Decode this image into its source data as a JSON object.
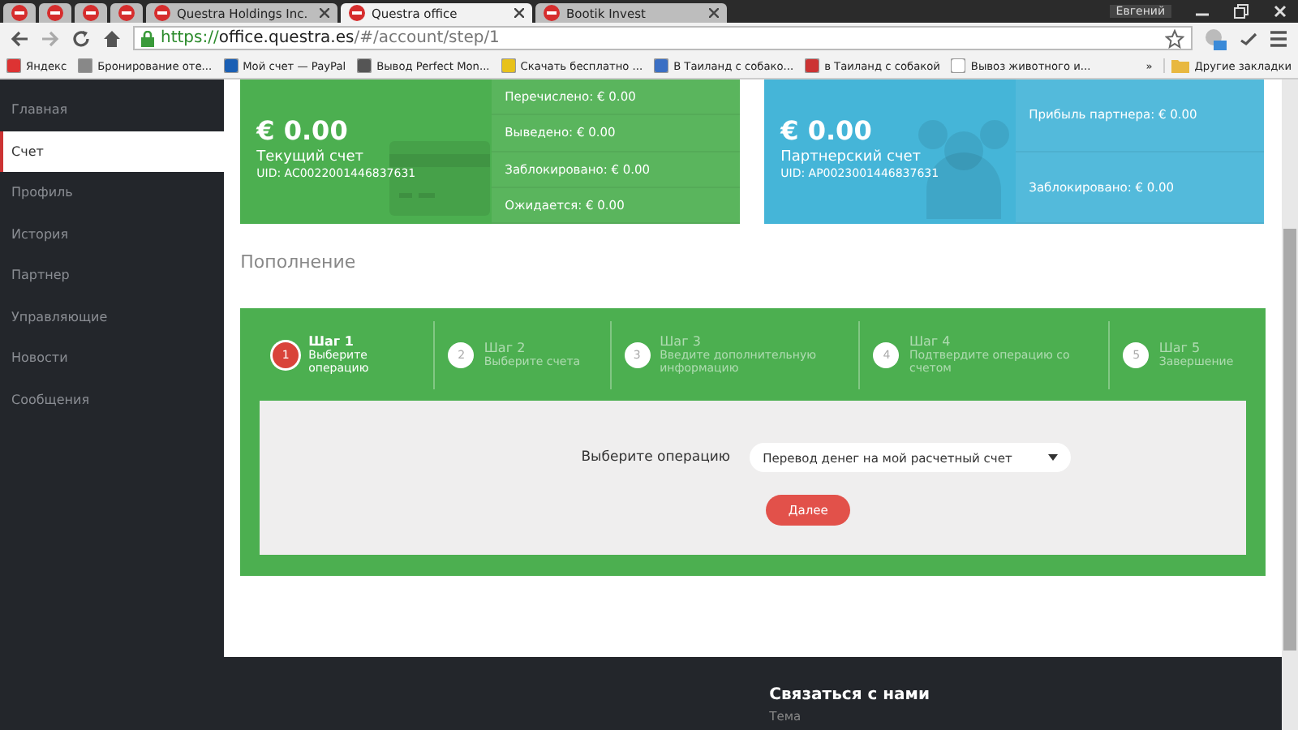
{
  "browser": {
    "tabs": [
      {
        "kind": "pinned",
        "selected": false
      },
      {
        "kind": "pinned",
        "selected": false
      },
      {
        "kind": "pinned",
        "selected": false
      },
      {
        "kind": "pinned",
        "selected": false
      },
      {
        "kind": "titled",
        "label": "Questra Holdings Inc.",
        "selected": false
      },
      {
        "kind": "titled",
        "label": "Questra office",
        "selected": true
      },
      {
        "kind": "titled",
        "label": "Bootik Invest",
        "selected": false
      }
    ],
    "user": "Евгений",
    "url": {
      "scheme": "https://",
      "host": "office.questra.es",
      "path": "/#/account/step/1"
    },
    "bookmarks": [
      "Яндекс",
      "Бронирование оте...",
      "Мой счет — PayPal",
      "Вывод Perfect Mon...",
      "Скачать бесплатно ...",
      "В Таиланд с собако...",
      "в Таиланд с собакой",
      "Вывоз животного и..."
    ],
    "more_bookmarks": "»",
    "other_bookmarks": "Другие закладки"
  },
  "sidebar": {
    "items": [
      {
        "label": "Главная",
        "selected": false
      },
      {
        "label": "Счет",
        "selected": true
      },
      {
        "label": "Профиль",
        "selected": false
      },
      {
        "label": "История",
        "selected": false
      },
      {
        "label": "Партнер",
        "selected": false
      },
      {
        "label": "Управляющие",
        "selected": false
      },
      {
        "label": "Новости",
        "selected": false
      },
      {
        "label": "Сообщения",
        "selected": false
      }
    ]
  },
  "accounts": [
    {
      "kind": "card",
      "color": "#4caf50",
      "amount": "€ 0.00",
      "name": "Текущий счет",
      "uid": "UID: AC0022001446837631",
      "stats": [
        "Перечислено: € 0.00",
        "Выведено: € 0.00",
        "Заблокировано: € 0.00",
        "Ожидается: € 0.00"
      ]
    },
    {
      "kind": "people",
      "color": "#45b5d8",
      "amount": "€ 0.00",
      "name": "Партнерский счет",
      "uid": "UID: AP0023001446837631",
      "stats": [
        "Прибыль партнера: € 0.00",
        "Заблокировано: € 0.00"
      ]
    }
  ],
  "section_title": "Пополнение",
  "steps": [
    {
      "number": "1",
      "title": "Шаг 1",
      "subtitle": "Выберите операцию",
      "selected": true
    },
    {
      "number": "2",
      "title": "Шаг 2",
      "subtitle": "Выберите счета",
      "selected": false
    },
    {
      "number": "3",
      "title": "Шаг 3",
      "subtitle": "Введите дополнительную информацию",
      "selected": false
    },
    {
      "number": "4",
      "title": "Шаг 4",
      "subtitle": "Подтвердите операцию со счетом",
      "selected": false
    },
    {
      "number": "5",
      "title": "Шаг 5",
      "subtitle": "Завершение",
      "selected": false
    }
  ],
  "form": {
    "label": "Выберите операцию",
    "select_value": "Перевод денег на мой расчетный счет",
    "button": "Далее"
  },
  "footer": {
    "title": "Связаться с нами",
    "field_label": "Тема"
  }
}
